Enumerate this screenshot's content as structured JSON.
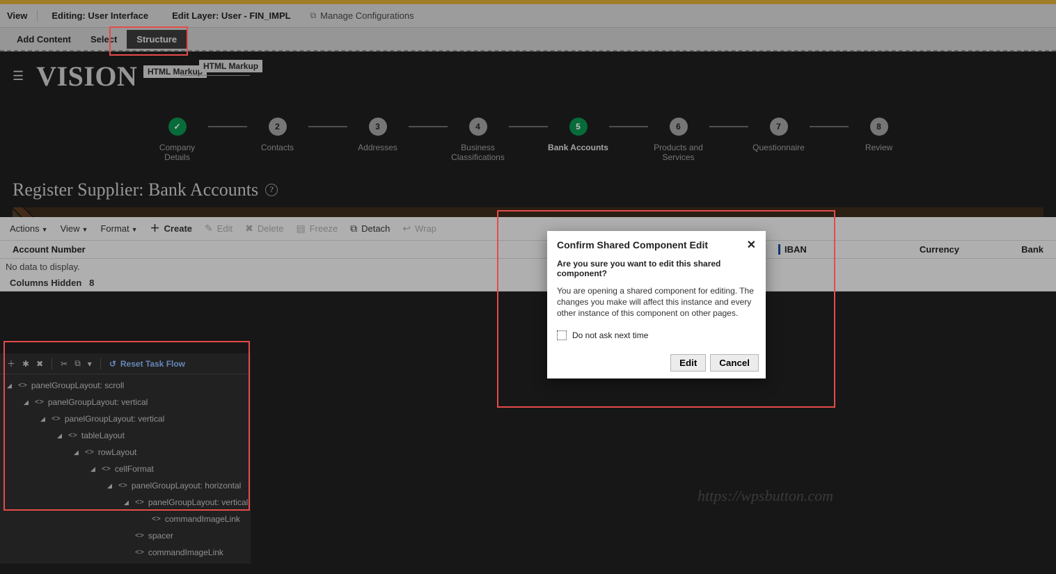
{
  "topbar": {
    "view_btn": "View",
    "editing": "Editing: User Interface",
    "edit_layer": "Edit Layer: User - FIN_IMPL",
    "manage_conf": "Manage Configurations"
  },
  "tabs": {
    "add_content": "Add Content",
    "select": "Select",
    "structure": "Structure"
  },
  "logo": "VISION",
  "markup_chip": "HTML Markup",
  "train": [
    {
      "num": "✓",
      "label": "Company Details",
      "state": "done"
    },
    {
      "num": "2",
      "label": "Contacts",
      "state": ""
    },
    {
      "num": "3",
      "label": "Addresses",
      "state": ""
    },
    {
      "num": "4",
      "label": "Business Classifications",
      "state": ""
    },
    {
      "num": "5",
      "label": "Bank Accounts",
      "state": "active"
    },
    {
      "num": "6",
      "label": "Products and Services",
      "state": ""
    },
    {
      "num": "7",
      "label": "Questionnaire",
      "state": ""
    },
    {
      "num": "8",
      "label": "Review",
      "state": ""
    }
  ],
  "page_title": "Register Supplier: Bank Accounts",
  "toolbar": {
    "actions": "Actions",
    "view": "View",
    "format": "Format",
    "create": "Create",
    "edit": "Edit",
    "delete": "Delete",
    "freeze": "Freeze",
    "detach": "Detach",
    "wrap": "Wrap"
  },
  "table": {
    "col_account": "Account Number",
    "col_iban": "IBAN",
    "col_currency": "Currency",
    "col_bank": "Bank",
    "nodata": "No data to display.",
    "cols_hidden_label": "Columns Hidden",
    "cols_hidden_count": "8"
  },
  "structure_panel": {
    "reset": "Reset Task Flow",
    "nodes": [
      {
        "indent": 0,
        "expand": true,
        "label": "panelGroupLayout: scroll"
      },
      {
        "indent": 1,
        "expand": true,
        "label": "panelGroupLayout: vertical"
      },
      {
        "indent": 2,
        "expand": true,
        "label": "panelGroupLayout: vertical"
      },
      {
        "indent": 3,
        "expand": true,
        "label": "tableLayout"
      },
      {
        "indent": 4,
        "expand": true,
        "label": "rowLayout"
      },
      {
        "indent": 5,
        "expand": true,
        "label": "cellFormat"
      },
      {
        "indent": 6,
        "expand": true,
        "label": "panelGroupLayout: horizontal"
      },
      {
        "indent": 7,
        "expand": true,
        "label": "panelGroupLayout: vertical"
      },
      {
        "indent": 8,
        "expand": false,
        "label": "commandImageLink"
      },
      {
        "indent": 7,
        "expand": false,
        "label": "spacer"
      },
      {
        "indent": 7,
        "expand": false,
        "label": "commandImageLink"
      }
    ]
  },
  "dialog": {
    "title": "Confirm Shared Component Edit",
    "question": "Are you sure you want to edit this shared component?",
    "description": "You are opening a shared component for editing. The changes you make will affect this instance and every other instance of this component on other pages.",
    "checkbox_label": "Do not ask next time",
    "edit_btn": "Edit",
    "cancel_btn": "Cancel"
  },
  "watermark": "https://wpsbutton.com"
}
